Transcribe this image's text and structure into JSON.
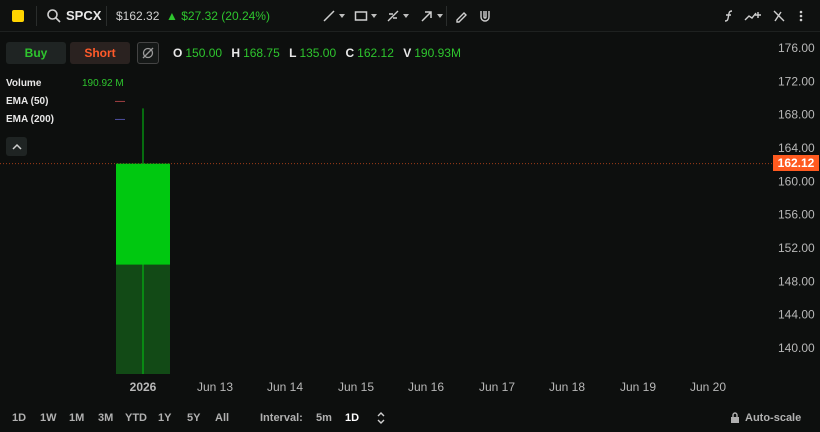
{
  "header": {
    "symbol": "SPCX",
    "price": "$162.32",
    "change": "$27.32 (20.24%)",
    "change_color": "#2ec52e",
    "brand_color": "#ffd400"
  },
  "actions": {
    "buy_label": "Buy",
    "short_label": "Short"
  },
  "ohlc": {
    "o_label": "O",
    "o_value": "150.00",
    "h_label": "H",
    "h_value": "168.75",
    "l_label": "L",
    "l_value": "135.00",
    "c_label": "C",
    "c_value": "162.12",
    "v_label": "V",
    "v_value": "190.93M"
  },
  "legend": {
    "volume_label": "Volume",
    "volume_value": "190.92 M",
    "ema50_label": "EMA (50)",
    "ema50_value": "—",
    "ema200_label": "EMA (200)",
    "ema200_value": "—",
    "ema50_color": "#e0555a",
    "ema200_color": "#6a6ae0"
  },
  "chart_data": {
    "type": "candlestick",
    "y_ticks": [
      176,
      172,
      168,
      164,
      160,
      156,
      152,
      148,
      144,
      140
    ],
    "y_tick_labels": [
      "176.00",
      "172.00",
      "168.00",
      "164.00",
      "160.00",
      "156.00",
      "152.00",
      "148.00",
      "144.00",
      "140.00"
    ],
    "ylim": [
      137,
      179
    ],
    "x_labels": [
      "2026",
      "Jun 13",
      "Jun 14",
      "Jun 15",
      "Jun 16",
      "Jun 17",
      "Jun 18",
      "Jun 19",
      "Jun 20"
    ],
    "candles": [
      {
        "x": "2026",
        "open": 150.0,
        "high": 168.75,
        "low": 135.0,
        "close": 162.12
      }
    ],
    "last_price": 162.12,
    "last_price_label": "162.12",
    "up_color": "#00c810",
    "volume_color": "#124a16",
    "last_price_color": "#ff5a1f"
  },
  "footer": {
    "ranges": [
      "1D",
      "1W",
      "1M",
      "3M",
      "YTD",
      "1Y",
      "5Y",
      "All"
    ],
    "interval_label": "Interval:",
    "interval_options": [
      "5m",
      "1D"
    ],
    "interval_selected": "1D",
    "autoscale_label": "Auto-scale"
  }
}
